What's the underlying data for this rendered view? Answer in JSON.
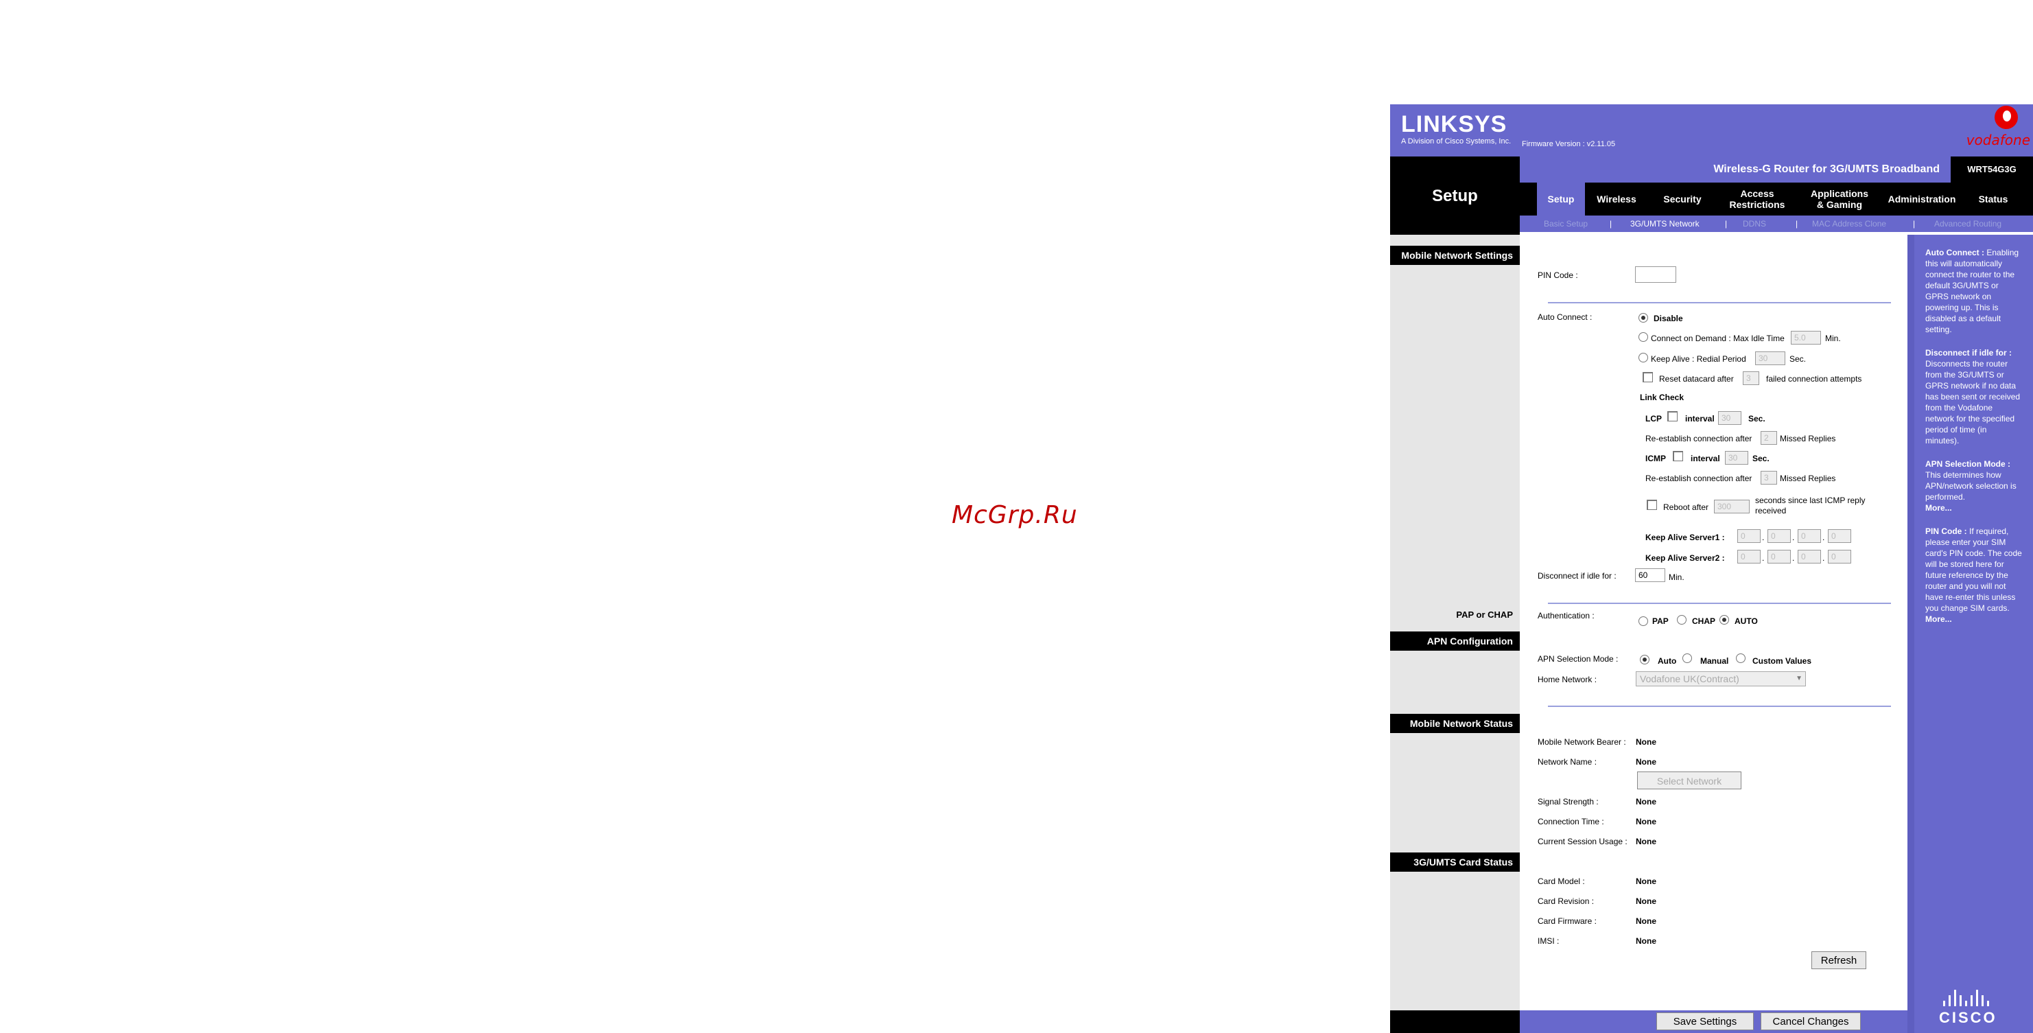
{
  "watermark": "McGrp.Ru",
  "header": {
    "logo": "LINKSYS",
    "logo_sub": "A Division of Cisco Systems, Inc.",
    "firmware": "Firmware Version : v2.11.05",
    "carrier": "vodafone",
    "product_name": "Wireless-G Router for 3G/UMTS Broadband",
    "model": "WRT54G3G",
    "section_title": "Setup"
  },
  "nav": {
    "tabs": [
      {
        "label": "Setup"
      },
      {
        "label": "Wireless"
      },
      {
        "label": "Security"
      },
      {
        "label": "Access\nRestrictions"
      },
      {
        "label": "Applications\n& Gaming"
      },
      {
        "label": "Administration"
      },
      {
        "label": "Status"
      }
    ],
    "subtabs": [
      {
        "label": "Basic Setup"
      },
      {
        "label": "3G/UMTS Network"
      },
      {
        "label": "DDNS"
      },
      {
        "label": "MAC Address Clone"
      },
      {
        "label": "Advanced Routing"
      }
    ],
    "separator": "|"
  },
  "sections": {
    "mobile_network_settings": "Mobile Network Settings",
    "pap_or_chap": "PAP or CHAP",
    "apn_configuration": "APN Configuration",
    "mobile_network_status": "Mobile Network Status",
    "card_status": "3G/UMTS Card Status"
  },
  "settings": {
    "pin_code_label": "PIN Code :",
    "pin_code_value": "",
    "auto_connect_label": "Auto Connect :",
    "disable": "Disable",
    "connect_on_demand": "Connect on Demand : Max Idle Time",
    "max_idle_value": "5.0",
    "min": "Min.",
    "keep_alive": "Keep Alive : Redial Period",
    "redial_value": "30",
    "sec": "Sec.",
    "reset_datacard": "Reset datacard after",
    "reset_value": "3",
    "failed_attempts": "failed connection attempts",
    "link_check": "Link Check",
    "lcp": "LCP",
    "interval": "interval",
    "lcp_interval_value": "30",
    "reestablish": "Re-establish connection after",
    "lcp_missed_value": "2",
    "missed_replies": "Missed Replies",
    "icmp": "ICMP",
    "icmp_interval_value": "30",
    "icmp_missed_value": "3",
    "reboot_after": "Reboot after",
    "reboot_value": "300",
    "reboot_suffix": "seconds since last ICMP reply received",
    "keep_alive_server1": "Keep Alive Server1 :",
    "keep_alive_server2": "Keep Alive Server2 :",
    "server1": [
      "0",
      "0",
      "0",
      "0"
    ],
    "server2": [
      "0",
      "0",
      "0",
      "0"
    ],
    "ip_dot": ".",
    "disconnect_label": "Disconnect if idle for :",
    "disconnect_value": "60",
    "authentication_label": "Authentication :",
    "pap": "PAP",
    "chap": "CHAP",
    "auto": "AUTO",
    "apn_mode_label": "APN Selection Mode :",
    "apn_auto": "Auto",
    "apn_manual": "Manual",
    "apn_custom": "Custom Values",
    "home_network_label": "Home Network :",
    "home_network_value": "Vodafone UK(Contract)"
  },
  "status": {
    "bearer_label": "Mobile Network  Bearer :",
    "bearer_value": "None",
    "network_name_label": "Network Name :",
    "network_name_value": "None",
    "select_network": "Select Network",
    "signal_label": "Signal Strength :",
    "signal_value": "None",
    "connection_time_label": "Connection Time :",
    "connection_time_value": "None",
    "session_usage_label": "Current Session Usage :",
    "session_usage_value": "None",
    "card_model_label": "Card Model :",
    "card_model_value": "None",
    "card_revision_label": "Card Revision :",
    "card_revision_value": "None",
    "card_firmware_label": "Card Firmware :",
    "card_firmware_value": "None",
    "imsi_label": "IMSI :",
    "imsi_value": "None",
    "refresh": "Refresh"
  },
  "footer": {
    "save": "Save Settings",
    "cancel": "Cancel Changes",
    "cisco": "CISCO"
  },
  "help": {
    "auto_connect_title": "Auto Connect :",
    "auto_connect_text": "Enabling this will automatically connect the router to the default 3G/UMTS or GPRS network on powering up. This is disabled as a default setting.",
    "disconnect_title": "Disconnect if idle for :",
    "disconnect_text": "Disconnects the router from the 3G/UMTS or GPRS network if no data has been sent or received from the Vodafone network for the specified period of time (in minutes).",
    "apn_title": "APN Selection Mode :",
    "apn_text": "This determines how APN/network selection is performed.",
    "more": "More...",
    "pin_title": "PIN Code :",
    "pin_text": "If required, please enter your SIM card's PIN code. The code will be stored here for future reference by the router and you will not have re-enter this unless you change SIM cards."
  }
}
